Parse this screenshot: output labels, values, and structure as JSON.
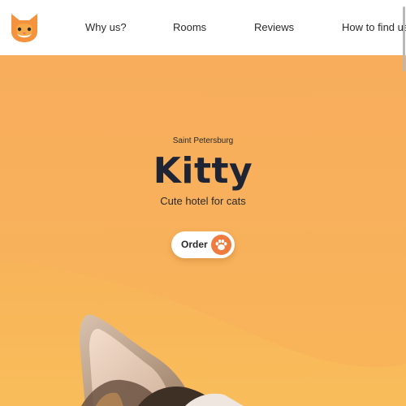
{
  "header": {
    "logo_icon": "cat-face-icon",
    "nav": [
      {
        "label": "Why us?"
      },
      {
        "label": "Rooms"
      },
      {
        "label": "Reviews"
      },
      {
        "label": "How to find us"
      }
    ]
  },
  "hero": {
    "city": "Saint Petersburg",
    "title": "Kitty",
    "subtitle": "Cute hotel for cats",
    "order_label": "Order",
    "order_icon": "paw-icon"
  },
  "colors": {
    "hero_orange": "#f7ad5c",
    "wave_orange": "#f9b557",
    "title_navy": "#1f2435",
    "paw_badge": "#f07b3f",
    "logo_orange": "#f4923d"
  }
}
